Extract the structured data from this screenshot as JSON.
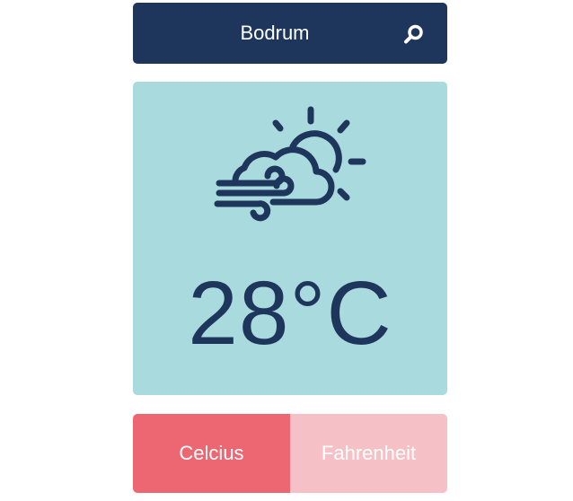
{
  "search": {
    "city": "Bodrum",
    "icon": "search-icon"
  },
  "weather": {
    "icon": "partly-cloudy-windy-icon",
    "temperature": "28°C"
  },
  "units": {
    "celsius_label": "Celcius",
    "fahrenheit_label": "Fahrenheit",
    "selected": "celsius"
  },
  "colors": {
    "navy": "#1e365c",
    "card_background": "#a9dadd",
    "celsius_active": "#ec6772",
    "fahrenheit_inactive": "#f6c1c6"
  }
}
